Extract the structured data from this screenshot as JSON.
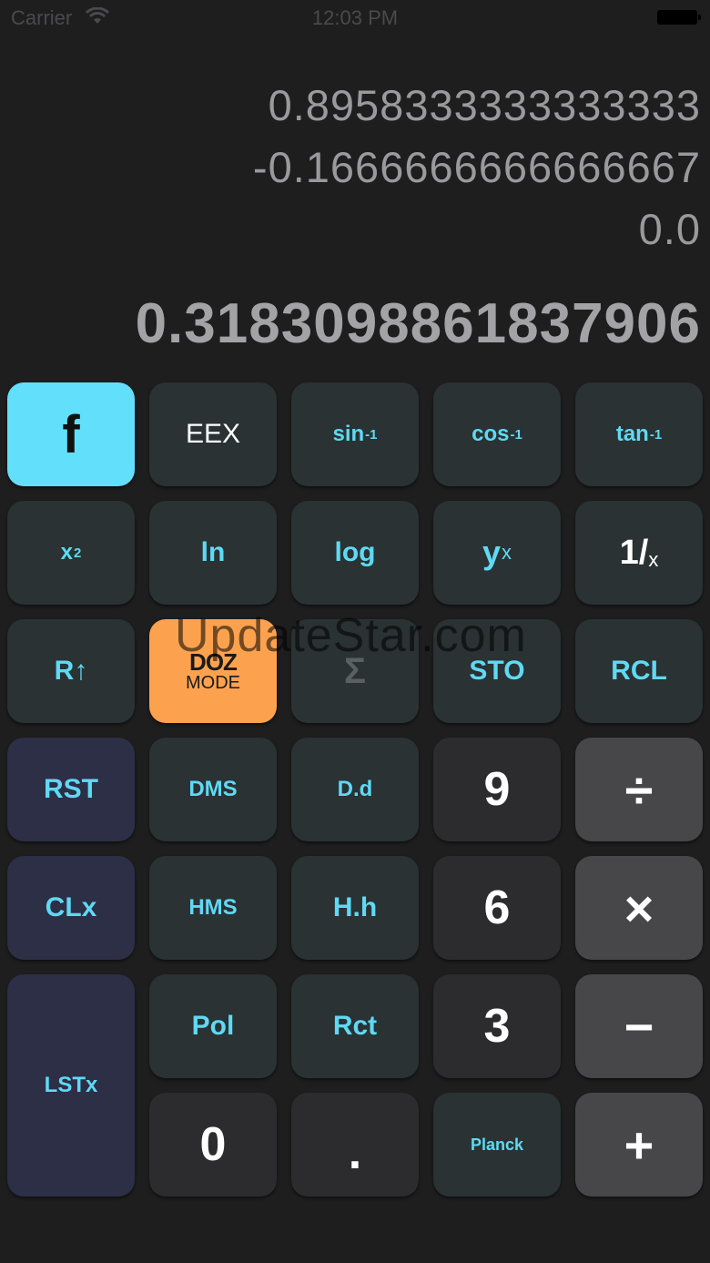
{
  "status": {
    "carrier": "Carrier",
    "time": "12:03 PM"
  },
  "display": {
    "stack_t": "0.8958333333333333",
    "stack_z": "-0.1666666666666667",
    "stack_y": "0.0",
    "x_register": "0.3183098861837906"
  },
  "watermark": "UpdateStar.com",
  "keys": {
    "f": "f",
    "eex": "EEX",
    "asin": "sin",
    "acos": "cos",
    "atan": "tan",
    "inv_sup": "-1",
    "square_base": "x",
    "square_sup": "2",
    "ln": "ln",
    "log": "log",
    "power_base": "y",
    "power_sup": "x",
    "recip_num": "1/",
    "recip_den": "x",
    "roll_up": "R↑",
    "doz_top": "DOZ",
    "doz_bottom": "MODE",
    "sigma": "Σ",
    "sto": "STO",
    "rcl": "RCL",
    "rst": "RST",
    "dms": "DMS",
    "dd": "D.d",
    "nine": "9",
    "divide": "÷",
    "clx": "CLx",
    "hms": "HMS",
    "hh": "H.h",
    "six": "6",
    "multiply": "×",
    "lstx": "LSTx",
    "pol": "Pol",
    "rct": "Rct",
    "three": "3",
    "minus": "−",
    "zero": "0",
    "dot": ".",
    "planck": "Planck",
    "plus": "+"
  },
  "colors": {
    "accent_cyan": "#62dffb",
    "doz_orange": "#fca24f",
    "key_teal": "#2a3233",
    "key_navy": "#2c2f45",
    "label_cyan": "#5fd9f4"
  }
}
